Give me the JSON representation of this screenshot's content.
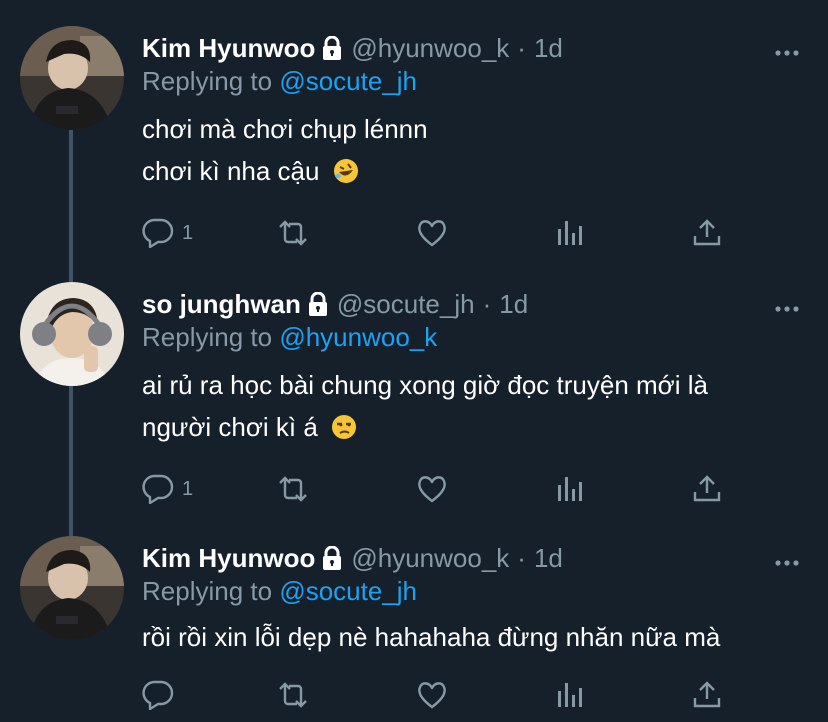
{
  "tweets": [
    {
      "display_name": "Kim Hyunwoo",
      "handle": "@hyunwoo_k",
      "separator": "·",
      "time": "1d",
      "replying_prefix": "Replying to",
      "replying_to": "@socute_jh",
      "lines": [
        "chơi mà chơi chụp lénnn",
        "chơi kì nha cậu"
      ],
      "emoji": "rolling-on-floor-laughing",
      "reply_count": "1",
      "verified_lock": true
    },
    {
      "display_name": "so junghwan",
      "handle": "@socute_jh",
      "separator": "·",
      "time": "1d",
      "replying_prefix": "Replying to",
      "replying_to": "@hyunwoo_k",
      "lines": [
        "ai rủ ra học bài chung xong giờ đọc truyện mới là",
        "người chơi kì á"
      ],
      "emoji": "unamused-face",
      "reply_count": "1",
      "verified_lock": true
    },
    {
      "display_name": "Kim Hyunwoo",
      "handle": "@hyunwoo_k",
      "separator": "·",
      "time": "1d",
      "replying_prefix": "Replying to",
      "replying_to": "@socute_jh",
      "lines": [
        "rồi rồi xin lỗi dẹp nè hahahaha đừng nhăn nữa mà"
      ],
      "emoji": "",
      "reply_count": "",
      "verified_lock": true
    }
  ],
  "colors": {
    "background": "#15202b",
    "text_primary": "#ffffff",
    "text_secondary": "#8899a6",
    "link": "#1da1f2",
    "thread_line": "#3d5466"
  },
  "icons": [
    "lock-icon",
    "more-icon",
    "reply-icon",
    "retweet-icon",
    "like-icon",
    "analytics-icon",
    "share-icon"
  ]
}
